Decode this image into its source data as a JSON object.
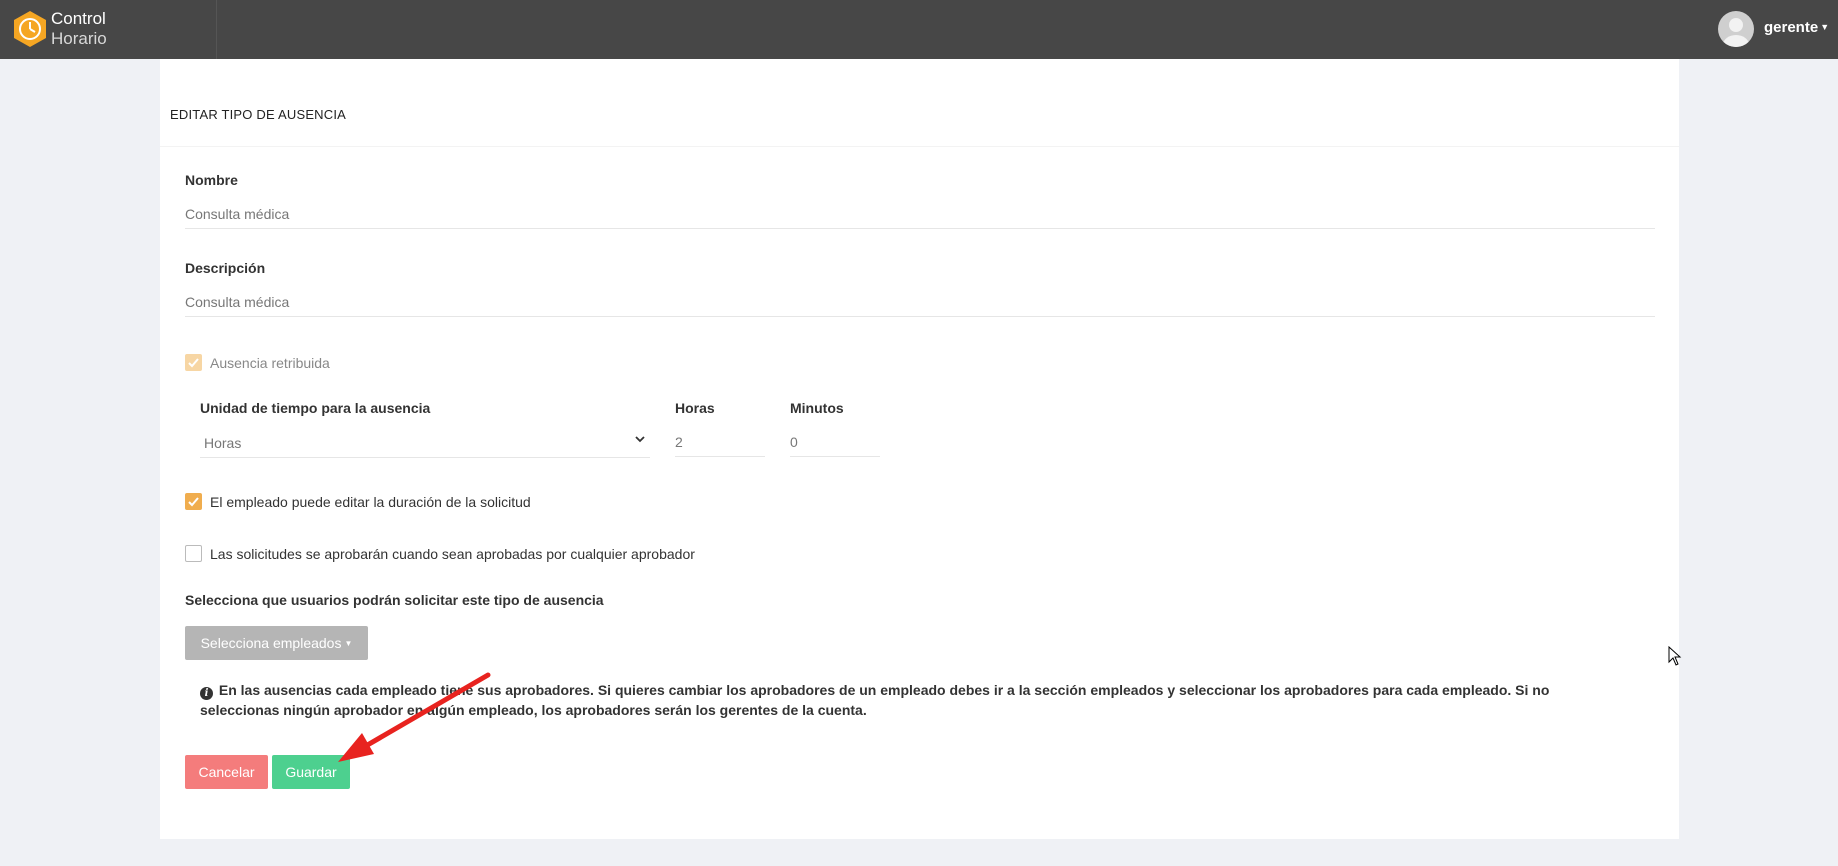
{
  "app": {
    "brand_line1": "Control",
    "brand_line2": "Horario"
  },
  "user": {
    "name": "gerente"
  },
  "page": {
    "title": "EDITAR TIPO DE AUSENCIA"
  },
  "form": {
    "nombre_label": "Nombre",
    "nombre_value": "Consulta médica",
    "descripcion_label": "Descripción",
    "descripcion_value": "Consulta médica",
    "paid_label": "Ausencia retribuida",
    "paid_checked": true,
    "unit_label": "Unidad de tiempo para la ausencia",
    "unit_value": "Horas",
    "hours_label": "Horas",
    "hours_value": "2",
    "minutes_label": "Minutos",
    "minutes_value": "0",
    "edit_duration_label": "El empleado puede editar la duración de la solicitud",
    "edit_duration_checked": true,
    "any_approver_label": "Las solicitudes se aprobarán cuando sean aprobadas por cualquier aprobador",
    "any_approver_checked": false,
    "users_label": "Selecciona que usuarios podrán solicitar este tipo de ausencia",
    "select_employees_label": "Selecciona empleados",
    "info_text": "En las ausencias cada empleado tiene sus aprobadores. Si quieres cambiar los aprobadores de un empleado debes ir a la sección empleados y seleccionar los aprobadores para cada empleado. Si no seleccionas ningún aprobador en algún empleado, los aprobadores serán los gerentes de la cuenta.",
    "cancel_label": "Cancelar",
    "save_label": "Guardar"
  },
  "colors": {
    "topbar": "#474747",
    "accent": "#f0ad4e",
    "cancel": "#f47c7c",
    "save": "#4dd08f",
    "annotation_arrow": "#e8231f"
  }
}
